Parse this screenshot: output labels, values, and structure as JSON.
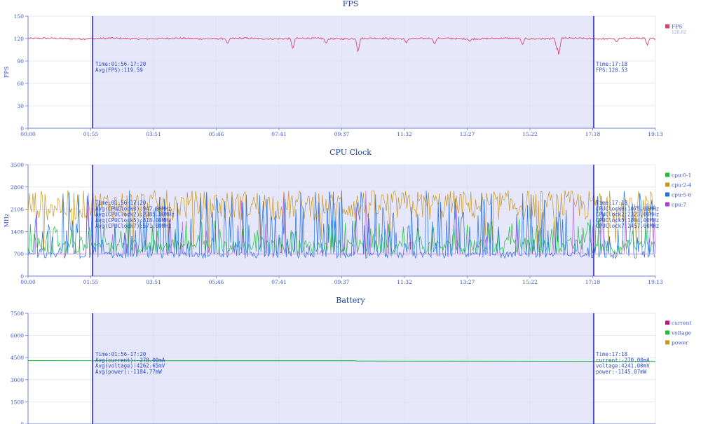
{
  "chart_data": [
    {
      "type": "line",
      "title": "FPS",
      "ylabel": "FPS",
      "yticks": [
        0,
        30,
        60,
        90,
        120,
        150
      ],
      "ylim": [
        0,
        150
      ],
      "xticks": [
        "00:00",
        "01:55",
        "03:51",
        "05:46",
        "07:41",
        "09:37",
        "11:32",
        "13:27",
        "15:22",
        "17:18",
        "19:13"
      ],
      "selection": [
        "01:56",
        "17:20"
      ],
      "grid": true,
      "legend_position": "right",
      "legend": [
        {
          "name": "FPS",
          "color": "#d9456a",
          "value": "120.62"
        }
      ],
      "series": [
        {
          "name": "FPS",
          "color": "#d9456a",
          "base": 120,
          "dips": [
            {
              "t": 0.318,
              "v": 113
            },
            {
              "t": 0.422,
              "v": 105
            },
            {
              "t": 0.475,
              "v": 113
            },
            {
              "t": 0.526,
              "v": 101
            },
            {
              "t": 0.603,
              "v": 114
            },
            {
              "t": 0.648,
              "v": 112
            },
            {
              "t": 0.704,
              "v": 116
            },
            {
              "t": 0.788,
              "v": 111
            },
            {
              "t": 0.843,
              "v": 105
            },
            {
              "t": 0.846,
              "v": 97
            },
            {
              "t": 0.938,
              "v": 115
            },
            {
              "t": 0.987,
              "v": 111
            }
          ]
        }
      ],
      "annotations": {
        "left": [
          "Time:01:56-17:20",
          "Avg(FPS):119.59"
        ],
        "right": [
          "Time:17:18",
          "FPS:120.53"
        ]
      }
    },
    {
      "type": "line",
      "title": "CPU Clock",
      "ylabel": "MHz",
      "yticks": [
        0,
        700,
        1400,
        2100,
        2800,
        3500
      ],
      "ylim": [
        0,
        3500
      ],
      "xticks": [
        "00:00",
        "01:55",
        "03:51",
        "05:46",
        "07:41",
        "09:37",
        "11:32",
        "13:27",
        "15:22",
        "17:18",
        "19:13"
      ],
      "selection": [
        "01:56",
        "17:20"
      ],
      "grid": true,
      "legend_position": "right",
      "legend": [
        {
          "name": "cpu:0-1",
          "color": "#1fbf3a"
        },
        {
          "name": "cpu:2-4",
          "color": "#c9961a"
        },
        {
          "name": "cpu:5-6",
          "color": "#1f6fe0"
        },
        {
          "name": "cpu:7",
          "color": "#b23ad6"
        }
      ],
      "series": [
        {
          "name": "cpu:0-1",
          "color": "#1fbf3a",
          "low": 700,
          "high": 1750,
          "base": 700
        },
        {
          "name": "cpu:2-4",
          "color": "#c9961a",
          "low": 1700,
          "high": 2700,
          "base": 2300
        },
        {
          "name": "cpu:5-6",
          "color": "#1f6fe0",
          "low": 550,
          "high": 2700,
          "base": 600
        },
        {
          "name": "cpu:7",
          "color": "#b23ad6",
          "low": 700,
          "high": 2700,
          "base": 700
        }
      ],
      "annotations": {
        "left": [
          "Time:01:56-17:20",
          "Avg(CPUClock0):947.00MHz",
          "Avg(CPUClock2):2385.00MHz",
          "Avg(CPUClock5):818.00MHz",
          "Avg(CPUClock7):571.00MHz"
        ],
        "right": [
          "Time:17:18",
          "CPUClock0:1075.00MHz",
          "CPUClock2:2323.00MHz",
          "CPUClock5:1804.00MHz",
          "CPUClock7:2457.00MHz"
        ]
      }
    },
    {
      "type": "line",
      "title": "Battery",
      "ylabel": "",
      "yticks": [
        0,
        1500,
        3000,
        4500,
        6000,
        7500
      ],
      "ylim": [
        0,
        7500
      ],
      "xticks": [],
      "selection": [
        "01:56",
        "17:20"
      ],
      "grid": true,
      "legend_position": "right",
      "legend": [
        {
          "name": "current",
          "color": "#c0157a"
        },
        {
          "name": "voltage",
          "color": "#1fbf3a"
        },
        {
          "name": "power",
          "color": "#c9961a"
        }
      ],
      "series": [
        {
          "name": "voltage",
          "color": "#1fbf3a",
          "values": [
            {
              "t": 0.0,
              "v": 4290
            },
            {
              "t": 0.52,
              "v": 4285
            },
            {
              "t": 0.525,
              "v": 4262
            },
            {
              "t": 1.0,
              "v": 4241
            }
          ]
        }
      ],
      "annotations": {
        "left": [
          "Time:01:56-17:20",
          "Avg(current):-278.00mA",
          "Avg(voltage):4262.65mV",
          "Avg(power):-1184.77mW"
        ],
        "right": [
          "Time:17:18",
          "current:-270.00mA",
          "voltage:4241.00mV",
          "power:-1145.07mW"
        ]
      }
    }
  ]
}
